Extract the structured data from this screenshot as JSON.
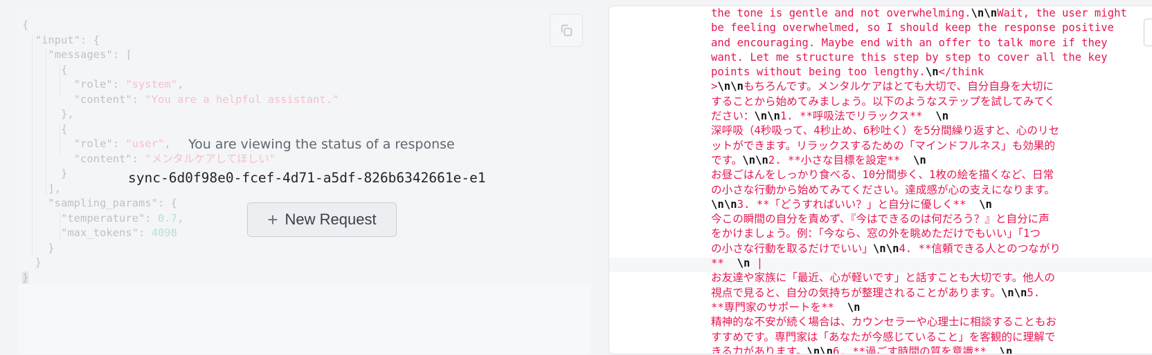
{
  "request": {
    "input_key": "input",
    "messages_key": "messages",
    "messages": [
      {
        "role": "system",
        "content": "You are a helpful assistant."
      },
      {
        "role": "user",
        "content": "メンタルケアしてほしい"
      }
    ],
    "sampling_params_key": "sampling_params",
    "temperature": "0.7",
    "max_tokens": "4098"
  },
  "status": {
    "message": "You are viewing the status of a response",
    "response_id": "sync-6d0f98e0-fcef-4d71-a5df-826b6342661e-e1"
  },
  "actions": {
    "new_request_label": "New Request",
    "copy_icon": "copy-icon",
    "plus_icon": "plus-icon"
  },
  "response": {
    "lines": [
      [
        [
          "t",
          "the tone is gentle and not overwhelming."
        ],
        [
          "b",
          "\\n\\n"
        ],
        [
          "t",
          "Wait, the user might"
        ]
      ],
      [
        [
          "t",
          "be feeling overwhelmed, so I should keep the response positive"
        ]
      ],
      [
        [
          "t",
          "and encouraging. Maybe end with an offer to talk more if they"
        ]
      ],
      [
        [
          "t",
          "want. Let me structure this step by step to cover all the key"
        ]
      ],
      [
        [
          "t",
          "points without being too lengthy."
        ],
        [
          "b",
          "\\n"
        ],
        [
          "t",
          "</think"
        ]
      ],
      [
        [
          "t",
          ">"
        ],
        [
          "b",
          "\\n\\n"
        ],
        [
          "t",
          "もちろんです。メンタルケアはとても大切で、自分自身を大切に"
        ]
      ],
      [
        [
          "t",
          "することから始めてみましょう。以下のようなステップを試してみてく"
        ]
      ],
      [
        [
          "t",
          "ださい："
        ],
        [
          "b",
          "\\n\\n"
        ],
        [
          "t",
          "1. **呼吸法でリラックス**  "
        ],
        [
          "b",
          "\\n"
        ]
      ],
      [
        [
          "t",
          "深呼吸（4秒吸って、4秒止め、6秒吐く）を5分間繰り返すと、心のリセ"
        ]
      ],
      [
        [
          "t",
          "ットができます。リラックスするための「マインドフルネス」も効果的"
        ]
      ],
      [
        [
          "t",
          "です。"
        ],
        [
          "b",
          "\\n\\n"
        ],
        [
          "t",
          "2. **小さな目標を設定**  "
        ],
        [
          "b",
          "\\n"
        ]
      ],
      [
        [
          "t",
          "お昼ごはんをしっかり食べる、10分間歩く、1枚の絵を描くなど、日常"
        ]
      ],
      [
        [
          "t",
          "の小さな行動から始めてみてください。達成感が心の支えになります。"
        ]
      ],
      [
        [
          "b",
          "\\n\\n"
        ],
        [
          "t",
          "3. **「どうすればいい？」と自分に優しく**  "
        ],
        [
          "b",
          "\\n"
        ]
      ],
      [
        [
          "t",
          "今この瞬間の自分を責めず、『今はできるのは何だろう？』と自分に声"
        ]
      ],
      [
        [
          "t",
          "をかけましょう。例：「今なら、窓の外を眺めただけでもいい」「1つ"
        ]
      ],
      [
        [
          "t",
          "の小さな行動を取るだけでいい」"
        ],
        [
          "b",
          "\\n\\n"
        ],
        [
          "t",
          "4. **信頼できる人とのつながり"
        ]
      ],
      [
        [
          "t",
          "**  "
        ],
        [
          "b",
          "\\n"
        ],
        [
          "t",
          " |"
        ]
      ],
      [
        [
          "t",
          "お友達や家族に「最近、心が軽いです」と話すことも大切です。他人の"
        ]
      ],
      [
        [
          "t",
          "視点で見ると、自分の気持ちが整理されることがあります。"
        ],
        [
          "b",
          "\\n\\n"
        ],
        [
          "t",
          "5."
        ]
      ],
      [
        [
          "t",
          "**専門家のサポートを**  "
        ],
        [
          "b",
          "\\n"
        ]
      ],
      [
        [
          "t",
          "精神的な不安が続く場合は、カウンセラーや心理士に相談することもお"
        ]
      ],
      [
        [
          "t",
          "すすめです。専門家は「あなたが今感じていること」を客観的に理解で"
        ]
      ],
      [
        [
          "t",
          "きる力があります。"
        ],
        [
          "b",
          "\\n\\n"
        ],
        [
          "t",
          "6. **過ごす時間の質を意識**  "
        ],
        [
          "b",
          "\\n"
        ]
      ]
    ]
  }
}
